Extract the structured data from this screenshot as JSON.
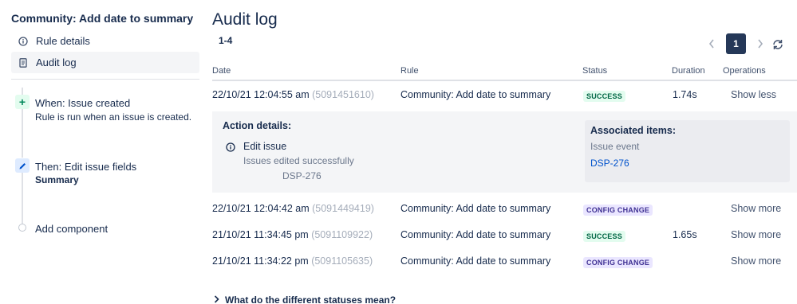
{
  "sidebar": {
    "rule_title": "Community: Add date to summary",
    "nav": [
      {
        "label": "Rule details",
        "icon": "info-icon"
      },
      {
        "label": "Audit log",
        "icon": "document-icon"
      }
    ],
    "components": [
      {
        "title": "When: Issue created",
        "subtitle": "Rule is run when an issue is created.",
        "icon": "plus-icon"
      },
      {
        "title": "Then: Edit issue fields",
        "subtitle": "Summary",
        "icon": "pencil-icon"
      },
      {
        "title": "Add component",
        "icon": "circle-icon"
      }
    ]
  },
  "main": {
    "title": "Audit log",
    "range": "1-4",
    "pager": {
      "current_page": "1"
    },
    "columns": [
      "Date",
      "Rule",
      "Status",
      "Duration",
      "Operations"
    ],
    "rows": [
      {
        "date": "22/10/21 12:04:55 am",
        "exec_id": "(5091451610)",
        "rule": "Community: Add date to summary",
        "status": "SUCCESS",
        "duration": "1.74s",
        "operation": "Show less"
      },
      {
        "date": "22/10/21 12:04:42 am",
        "exec_id": "(5091449419)",
        "rule": "Community: Add date to summary",
        "status": "CONFIG CHANGE",
        "duration": "",
        "operation": "Show more"
      },
      {
        "date": "21/10/21 11:34:45 pm",
        "exec_id": "(5091109922)",
        "rule": "Community: Add date to summary",
        "status": "SUCCESS",
        "duration": "1.65s",
        "operation": "Show more"
      },
      {
        "date": "21/10/21 11:34:22 pm",
        "exec_id": "(5091105635)",
        "rule": "Community: Add date to summary",
        "status": "CONFIG CHANGE",
        "duration": "",
        "operation": "Show more"
      }
    ],
    "details": {
      "action_title": "Action details:",
      "action_name": "Edit issue",
      "action_message": "Issues edited successfully",
      "action_issue": "DSP-276",
      "assoc_title": "Associated items:",
      "assoc_type": "Issue event",
      "assoc_link": "DSP-276"
    },
    "faq": "What do the different statuses mean?"
  },
  "colors": {
    "success_bg": "#e3fcef",
    "success_text": "#006644",
    "config_bg": "#eae6ff",
    "config_text": "#403294",
    "link": "#0052cc",
    "pager_active": "#253858"
  }
}
